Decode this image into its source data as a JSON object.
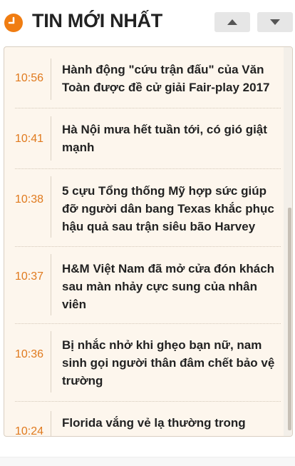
{
  "header": {
    "title": "TIN MỚI NHẤT",
    "icon": "clock-icon",
    "accent_color": "#f07d12",
    "prev_icon": "triangle-up-icon",
    "next_icon": "triangle-down-icon"
  },
  "news": {
    "items": [
      {
        "time": "10:56",
        "headline": "Hành động \"cứu trận đấu\" của Văn Toàn được đề cử giải Fair-play 2017"
      },
      {
        "time": "10:41",
        "headline": "Hà Nội mưa hết tuần tới, có gió giật mạnh"
      },
      {
        "time": "10:38",
        "headline": "5 cựu Tổng thống Mỹ hợp sức giúp đỡ người dân bang Texas khắc phục hậu quả sau trận siêu bão Harvey"
      },
      {
        "time": "10:37",
        "headline": "H&M Việt Nam đã mở cửa đón khách sau màn nhảy cực sung của nhân viên"
      },
      {
        "time": "10:36",
        "headline": "Bị nhắc nhở khi ghẹo bạn nữ, nam sinh gọi người thân đâm chết bảo vệ trường"
      },
      {
        "time": "10:24",
        "headline": "Florida vắng vẻ lạ thường trong"
      }
    ]
  }
}
